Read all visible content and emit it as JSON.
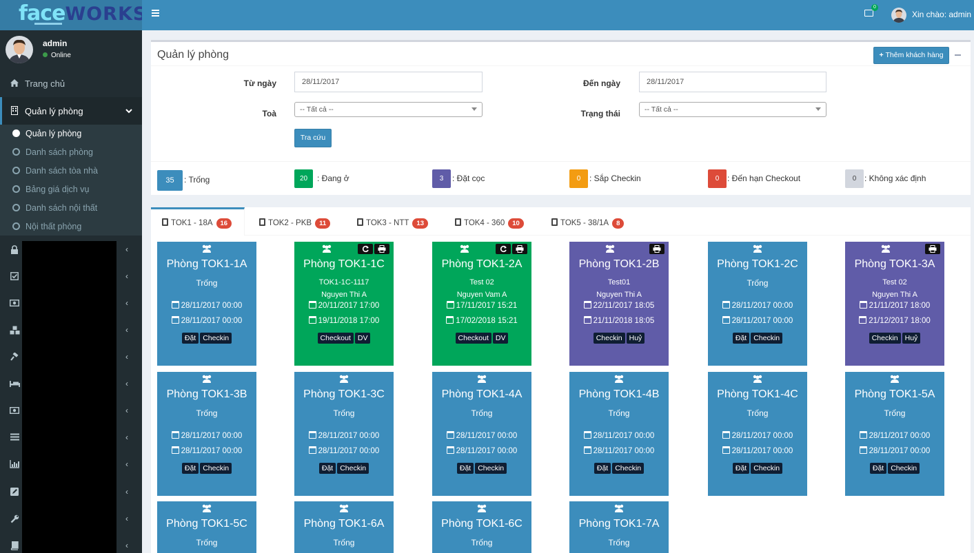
{
  "brand": {
    "part1": "face",
    "part2": "WORKS"
  },
  "user": {
    "name": "admin",
    "status": "Online"
  },
  "topbar": {
    "greeting": "Xin chào: admin",
    "mail_count": "0"
  },
  "sidebar": {
    "home": "Trang chủ",
    "room_mgmt": "Quản lý phòng",
    "sub": [
      "Quản lý phòng",
      "Danh sách phòng",
      "Danh sách tòa nhà",
      "Bảng giá dịch vụ",
      "Danh sách nội thất",
      "Nội thất phòng"
    ],
    "icons": [
      "lock-icon",
      "check-square-icon",
      "money-icon",
      "cubes-icon",
      "gavel-icon",
      "bed-icon",
      "money-icon",
      "list-icon",
      "bar-chart-icon",
      "edit-icon",
      "wrench-icon",
      "book-icon"
    ]
  },
  "box": {
    "title": "Quản lý phòng",
    "add_button": "Thêm khách hàng",
    "from_label": "Từ ngày",
    "from_value": "28/11/2017",
    "to_label": "Đến ngày",
    "to_value": "28/11/2017",
    "building_label": "Toà",
    "building_value": "-- Tất cả --",
    "state_label": "Trạng thái",
    "state_value": "-- Tất cả --",
    "search_button": "Tra cứu"
  },
  "legend": [
    {
      "count": "35",
      "label": ": Trống",
      "color": "#3c8dbc"
    },
    {
      "count": "20",
      "label": ": Đang ở",
      "color": "#00a65a"
    },
    {
      "count": "3",
      "label": ": Đặt cọc",
      "color": "#605ca8"
    },
    {
      "count": "0",
      "label": ": Sắp Checkin",
      "color": "#f39c12"
    },
    {
      "count": "0",
      "label": ": Đến hạn Checkout",
      "color": "#dd4b39"
    },
    {
      "count": "0",
      "label": ": Không xác định",
      "color": "#d2d6de"
    }
  ],
  "tabs": [
    {
      "label": "TOK1 - 18A",
      "count": "16"
    },
    {
      "label": "TOK2 - PKB",
      "count": "11"
    },
    {
      "label": "TOK3 - NTT",
      "count": "13"
    },
    {
      "label": "TOK4 - 360",
      "count": "10"
    },
    {
      "label": "TOK5 - 38/1A",
      "count": "8"
    }
  ],
  "rooms": [
    {
      "name": "Phòng TOK1-1A",
      "status": "Trống",
      "date1": "28/11/2017 00:00",
      "date2": "28/11/2017 00:00",
      "btn1": "Đặt",
      "btn2": "Checkin"
    },
    {
      "name": "Phòng TOK1-1C",
      "guest1": "TOK1-1C-1117",
      "guest2": "Nguyen Thi A",
      "date1": "20/11/2017 17:00",
      "date2": "19/11/2018 17:00",
      "btn1": "Checkout",
      "btn2": "DV"
    },
    {
      "name": "Phòng TOK1-2A",
      "guest1": "Test 02",
      "guest2": "Nguyen Vam A",
      "date1": "17/11/2017 15:21",
      "date2": "17/02/2018 15:21",
      "btn1": "Checkout",
      "btn2": "DV"
    },
    {
      "name": "Phòng TOK1-2B",
      "guest1": "Test01",
      "guest2": "Nguyen Thi A",
      "date1": "22/11/2017 18:05",
      "date2": "21/11/2018 18:05",
      "btn1": "Checkin",
      "btn2": "Huỷ"
    },
    {
      "name": "Phòng TOK1-2C",
      "status": "Trống",
      "date1": "28/11/2017 00:00",
      "date2": "28/11/2017 00:00",
      "btn1": "Đặt",
      "btn2": "Checkin"
    },
    {
      "name": "Phòng TOK1-3A",
      "guest1": "Test 02",
      "guest2": "Nguyen Thi A",
      "date1": "21/11/2017 18:00",
      "date2": "21/12/2017 18:00",
      "btn1": "Checkin",
      "btn2": "Huỷ"
    },
    {
      "name": "Phòng TOK1-3B",
      "status": "Trống",
      "date1": "28/11/2017 00:00",
      "date2": "28/11/2017 00:00",
      "btn1": "Đặt",
      "btn2": "Checkin"
    },
    {
      "name": "Phòng TOK1-3C",
      "status": "Trống",
      "date1": "28/11/2017 00:00",
      "date2": "28/11/2017 00:00",
      "btn1": "Đặt",
      "btn2": "Checkin"
    },
    {
      "name": "Phòng TOK1-4A",
      "status": "Trống",
      "date1": "28/11/2017 00:00",
      "date2": "28/11/2017 00:00",
      "btn1": "Đặt",
      "btn2": "Checkin"
    },
    {
      "name": "Phòng TOK1-4B",
      "status": "Trống",
      "date1": "28/11/2017 00:00",
      "date2": "28/11/2017 00:00",
      "btn1": "Đặt",
      "btn2": "Checkin"
    },
    {
      "name": "Phòng TOK1-4C",
      "status": "Trống",
      "date1": "28/11/2017 00:00",
      "date2": "28/11/2017 00:00",
      "btn1": "Đặt",
      "btn2": "Checkin"
    },
    {
      "name": "Phòng TOK1-5A",
      "status": "Trống",
      "date1": "28/11/2017 00:00",
      "date2": "28/11/2017 00:00",
      "btn1": "Đặt",
      "btn2": "Checkin"
    },
    {
      "name": "Phòng TOK1-5C",
      "status": "Trống"
    },
    {
      "name": "Phòng TOK1-6A",
      "status": "Trống"
    },
    {
      "name": "Phòng TOK1-6C",
      "status": "Trống"
    },
    {
      "name": "Phòng TOK1-7A",
      "status": "Trống"
    }
  ]
}
